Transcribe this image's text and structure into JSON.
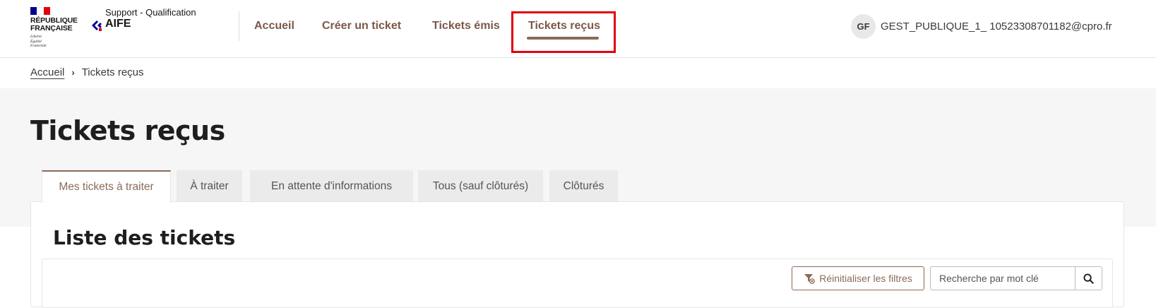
{
  "header": {
    "logo": {
      "lines": [
        "RÉPUBLIQUE",
        "FRANÇAISE"
      ],
      "motto": [
        "Liberté",
        "Égalité",
        "Fraternité"
      ],
      "flag_colors": [
        "#000091",
        "#ffffff",
        "#e1000f"
      ]
    },
    "service": {
      "subtitle": "Support - Qualification",
      "name": "AIFE"
    },
    "nav": [
      {
        "label": "Accueil"
      },
      {
        "label": "Créer un ticket"
      },
      {
        "label": "Tickets émis"
      },
      {
        "label": "Tickets reçus",
        "active": true
      }
    ],
    "user": {
      "initials": "GF",
      "email": "GEST_PUBLIQUE_1_ 10523308701182@cpro.fr"
    }
  },
  "breadcrumb": {
    "home": "Accueil",
    "separator": "›",
    "current": "Tickets reçus"
  },
  "page": {
    "title": "Tickets reçus"
  },
  "tabs": [
    {
      "label": "Mes tickets à traiter",
      "active": true
    },
    {
      "label": "À traiter"
    },
    {
      "label": "En attente d'informations"
    },
    {
      "label": "Tous (sauf clôturés)"
    },
    {
      "label": "Clôturés"
    }
  ],
  "list": {
    "title": "Liste des tickets",
    "reset_filters_label": "Réinitialiser les filtres",
    "search_placeholder": "Recherche par mot clé"
  },
  "colors": {
    "accent": "#8b6a58",
    "nav_text": "#7b5848",
    "highlight": "#e1000f",
    "band": "#f6f6f6"
  },
  "icons": [
    "filter-reset-icon",
    "search-icon",
    "aife-logo-icon",
    "chevron-right-icon"
  ]
}
